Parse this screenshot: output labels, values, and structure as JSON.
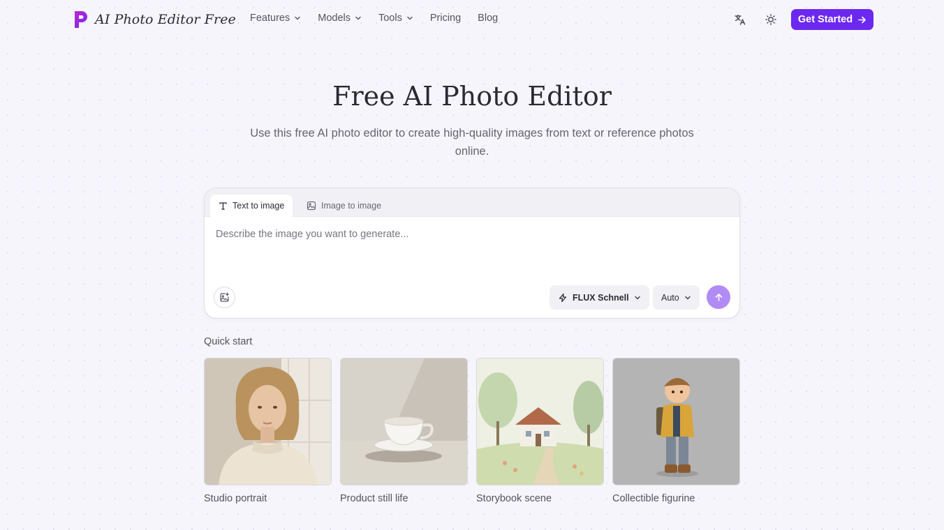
{
  "brand": {
    "name": "AI Photo Editor Free",
    "accent": "#6d28f0"
  },
  "nav": {
    "items": [
      {
        "label": "Features",
        "has_dropdown": true
      },
      {
        "label": "Models",
        "has_dropdown": true
      },
      {
        "label": "Tools",
        "has_dropdown": true
      },
      {
        "label": "Pricing",
        "has_dropdown": false
      },
      {
        "label": "Blog",
        "has_dropdown": false
      }
    ],
    "icons": [
      "translate-icon",
      "sun-icon"
    ],
    "cta_label": "Get Started"
  },
  "hero": {
    "title": "Free AI Photo Editor",
    "subtitle": "Use this free AI photo editor to create high-quality images from text or reference photos online."
  },
  "composer": {
    "tabs": [
      {
        "label": "Text to image",
        "active": true,
        "icon": "text-icon"
      },
      {
        "label": "Image to image",
        "active": false,
        "icon": "image-icon"
      }
    ],
    "placeholder": "Describe the image you want to generate...",
    "model": "FLUX Schnell",
    "aspect": "Auto"
  },
  "quick_start": {
    "label": "Quick start",
    "cards": [
      {
        "label": "Studio portrait"
      },
      {
        "label": "Product still life"
      },
      {
        "label": "Storybook scene"
      },
      {
        "label": "Collectible figurine"
      }
    ]
  }
}
